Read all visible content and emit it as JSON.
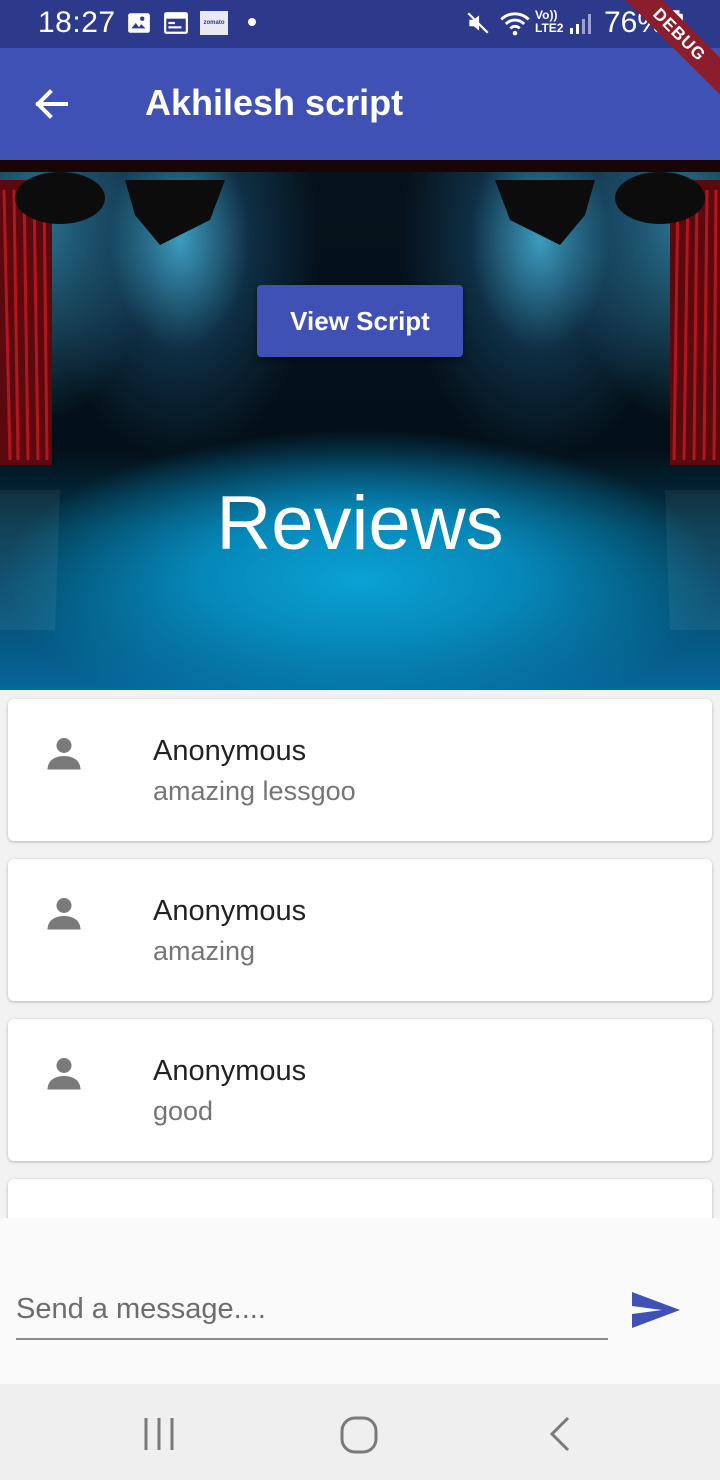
{
  "status_bar": {
    "time": "18:27",
    "zomato_label": "zomato",
    "volte_line1": "Vo))",
    "volte_line2": "LTE2",
    "battery_percent": "76%",
    "debug_label": "DEBUG"
  },
  "app_bar": {
    "title": "Akhilesh script",
    "back_icon": "arrow-back-icon"
  },
  "banner": {
    "view_script_label": "View Script",
    "heading": "Reviews"
  },
  "reviews": [
    {
      "author": "Anonymous",
      "comment": "amazing lessgoo",
      "icon": "person-icon"
    },
    {
      "author": "Anonymous",
      "comment": "amazing",
      "icon": "person-icon"
    },
    {
      "author": "Anonymous",
      "comment": "good",
      "icon": "person-icon"
    }
  ],
  "composer": {
    "placeholder": "Send a message....",
    "value": "",
    "send_icon": "send-icon"
  },
  "nav_bar": {
    "recents_icon": "recents-icon",
    "home_icon": "home-icon",
    "back_icon": "nav-back-icon"
  },
  "colors": {
    "primary": "#3f51b5",
    "status_bar": "#2d3a8c",
    "debug_ribbon": "#8b1d2c",
    "icon_grey": "#7a7a7a"
  }
}
